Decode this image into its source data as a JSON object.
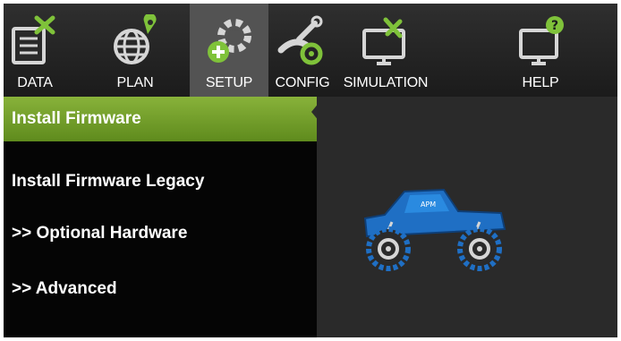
{
  "toolbar": {
    "items": [
      {
        "label": "DATA",
        "icon": "data-monitor-icon",
        "active": false
      },
      {
        "label": "PLAN",
        "icon": "globe-pin-icon",
        "active": false
      },
      {
        "label": "SETUP",
        "icon": "gear-setup-icon",
        "active": true
      },
      {
        "label": "CONFIG",
        "icon": "wrench-icon",
        "active": false
      },
      {
        "label": "SIMULATION",
        "icon": "monitor-plane-icon",
        "active": false
      },
      {
        "label": "HELP",
        "icon": "monitor-help-icon",
        "active": false
      }
    ]
  },
  "sidebar": {
    "items": [
      {
        "label": "Install Firmware",
        "selected": true
      },
      {
        "label": "Install Firmware Legacy",
        "selected": false
      },
      {
        "label": ">> Optional Hardware",
        "selected": false
      },
      {
        "label": ">> Advanced",
        "selected": false
      }
    ]
  },
  "vehicle": {
    "icon": "rover-truck-icon",
    "badge": "APM",
    "color": "#1f6fc4"
  },
  "colors": {
    "accent": "#7aa52e",
    "toolbar_active": "#535353",
    "sidebar_bg": "#050505",
    "main_bg": "#2a2a2a"
  }
}
